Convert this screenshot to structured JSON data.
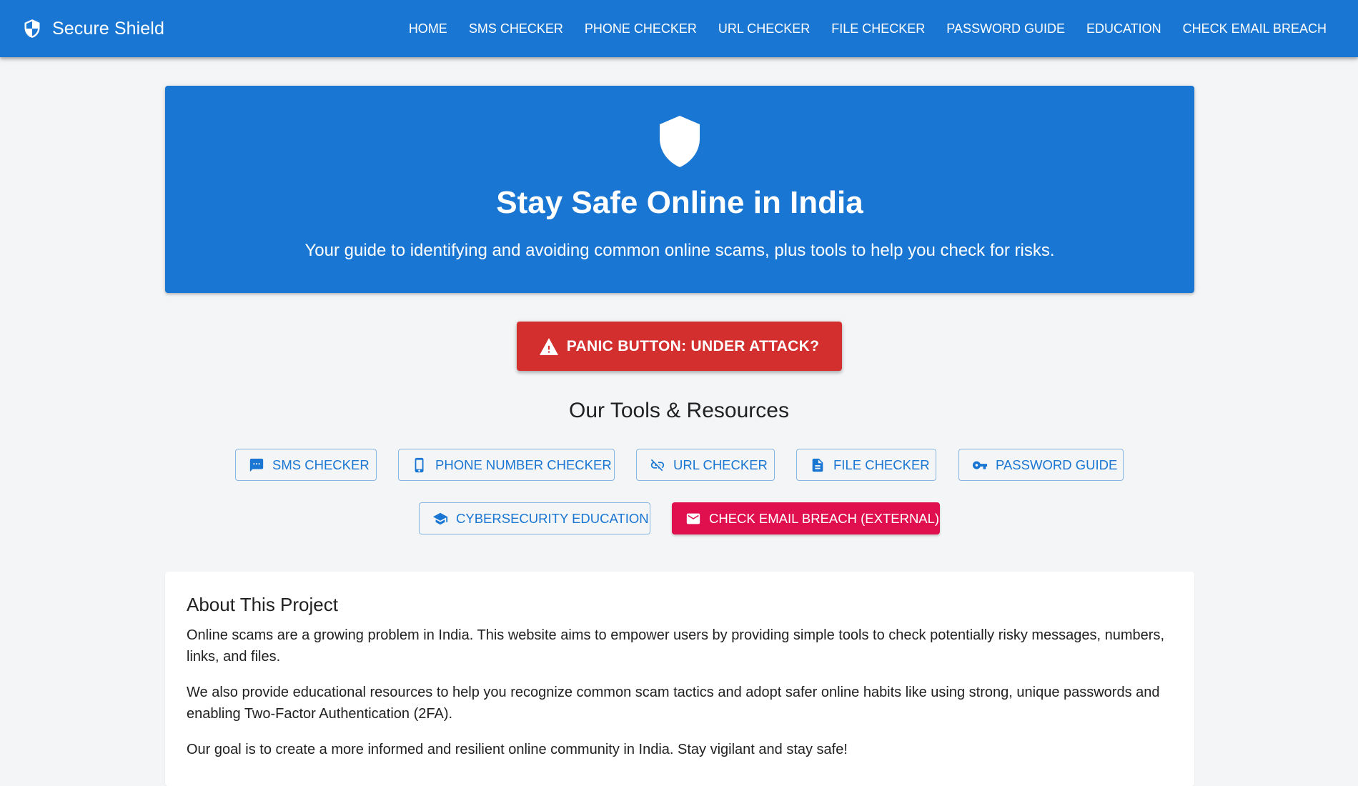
{
  "appbar": {
    "brand": "Secure Shield",
    "brand_icon": "shield-check-icon",
    "nav": [
      "HOME",
      "SMS CHECKER",
      "PHONE CHECKER",
      "URL CHECKER",
      "FILE CHECKER",
      "PASSWORD GUIDE",
      "EDUCATION",
      "CHECK EMAIL BREACH"
    ]
  },
  "hero": {
    "icon": "shield-icon",
    "title": "Stay Safe Online in India",
    "subtitle": "Your guide to identifying and avoiding common online scams, plus tools to help you check for risks."
  },
  "panic": {
    "icon": "warning-icon",
    "label": "PANIC BUTTON: UNDER ATTACK?"
  },
  "tools": {
    "title": "Our Tools & Resources",
    "items": [
      {
        "label": "SMS CHECKER",
        "icon": "sms-icon"
      },
      {
        "label": "PHONE NUMBER CHECKER",
        "icon": "phone-icon"
      },
      {
        "label": "URL CHECKER",
        "icon": "link-off-icon"
      },
      {
        "label": "FILE CHECKER",
        "icon": "file-icon"
      },
      {
        "label": "PASSWORD GUIDE",
        "icon": "key-icon"
      },
      {
        "label": "CYBERSECURITY EDUCATION",
        "icon": "school-icon"
      },
      {
        "label": "CHECK EMAIL BREACH (EXTERNAL)",
        "icon": "email-icon"
      }
    ]
  },
  "about": {
    "title": "About This Project",
    "paragraphs": [
      "Online scams are a growing problem in India. This website aims to empower users by providing simple tools to check potentially risky messages, numbers, links, and files.",
      "We also provide educational resources to help you recognize common scam tactics and adopt safer online habits like using strong, unique passwords and enabling Two-Factor Authentication (2FA).",
      "Our goal is to create a more informed and resilient online community in India. Stay vigilant and stay safe!"
    ]
  },
  "colors": {
    "primary": "#1976d2",
    "danger": "#d32f2f",
    "breach": "#e0104f",
    "background": "#f4f5f7"
  }
}
